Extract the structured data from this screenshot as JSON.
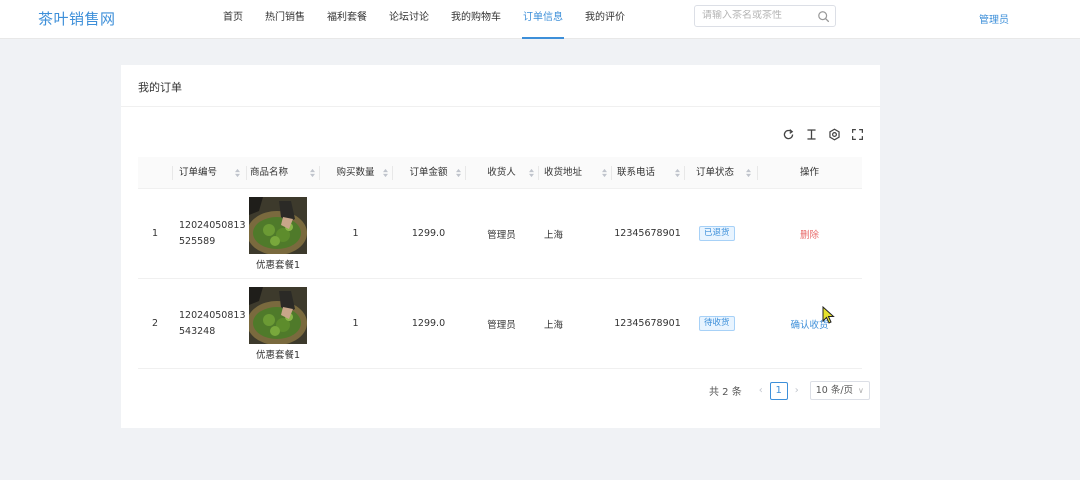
{
  "header": {
    "logo": "茶叶销售网",
    "nav": [
      {
        "label": "首页",
        "active": false
      },
      {
        "label": "热门销售",
        "active": false
      },
      {
        "label": "福利套餐",
        "active": false
      },
      {
        "label": "论坛讨论",
        "active": false
      },
      {
        "label": "我的购物车",
        "active": false
      },
      {
        "label": "订单信息",
        "active": true
      },
      {
        "label": "我的评价",
        "active": false
      }
    ],
    "search_placeholder": "请输入茶名或茶性",
    "user": "管理员"
  },
  "card": {
    "title": "我的订单"
  },
  "toolbar": {
    "icons": [
      "refresh-icon",
      "column-height-icon",
      "settings-icon",
      "fullscreen-icon"
    ]
  },
  "table": {
    "columns": [
      "订单编号",
      "商品名称",
      "购买数量",
      "订单金额",
      "收货人",
      "收货地址",
      "联系电话",
      "订单状态",
      "操作"
    ],
    "rows": [
      {
        "index": "1",
        "order_no": "12024050813525589",
        "product": "优惠套餐1",
        "quantity": "1",
        "amount": "1299.0",
        "receiver": "管理员",
        "address": "上海",
        "phone": "12345678901",
        "status": "已退货",
        "action": "删除"
      },
      {
        "index": "2",
        "order_no": "12024050813543248",
        "product": "优惠套餐1",
        "quantity": "1",
        "amount": "1299.0",
        "receiver": "管理员",
        "address": "上海",
        "phone": "12345678901",
        "status": "待收货",
        "action": "确认收货"
      }
    ]
  },
  "pagination": {
    "total": "共 2 条",
    "current_page": "1",
    "page_size": "10 条/页"
  },
  "colors": {
    "accent": "#3d8fd9",
    "danger": "#e86a6a",
    "background": "#f0f2f5"
  }
}
